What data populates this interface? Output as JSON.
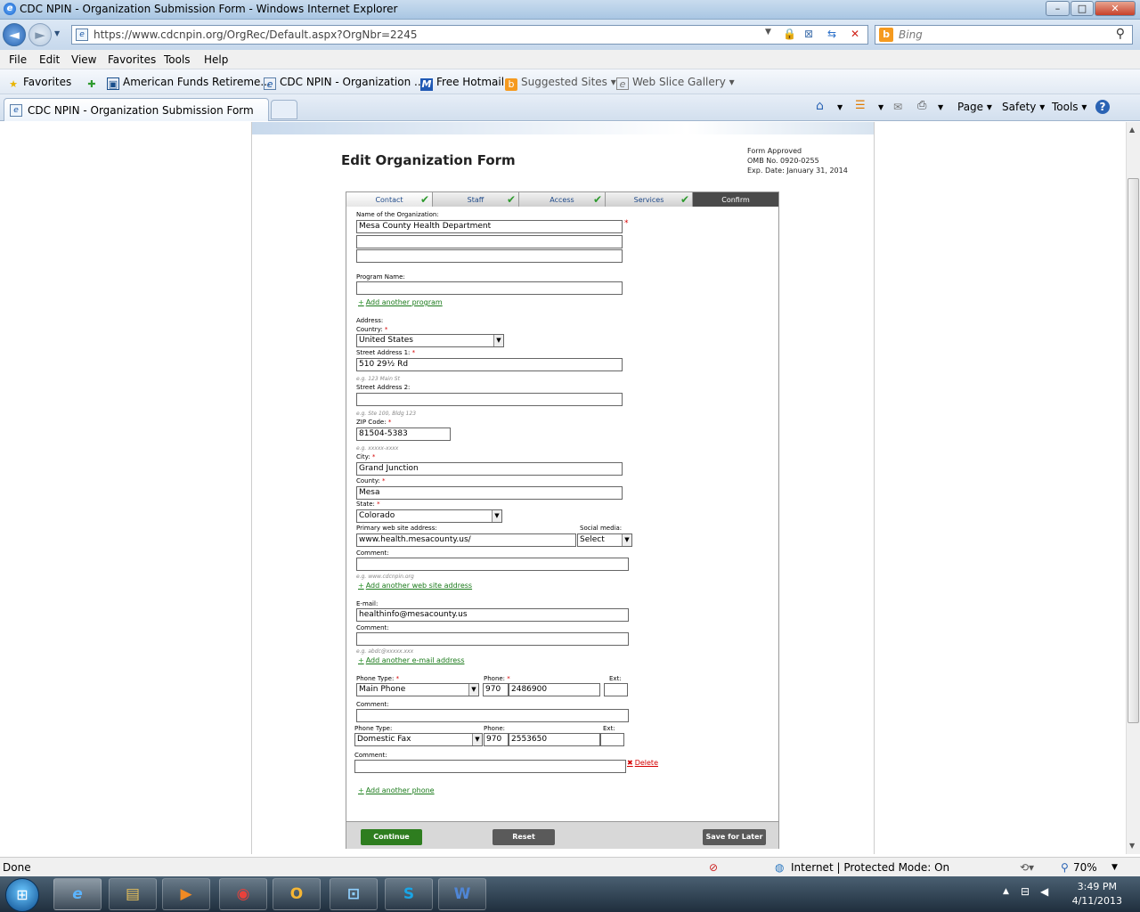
{
  "window": {
    "title": "CDC NPIN - Organization Submission Form - Windows Internet Explorer",
    "minimize": "–",
    "maximize": "□",
    "close": "✕"
  },
  "nav": {
    "url": "https://www.cdcnpin.org/OrgRec/Default.aspx?OrgNbr=2245",
    "search_placeholder": "Bing",
    "back": "◄",
    "forward": "►"
  },
  "menu": [
    "File",
    "Edit",
    "View",
    "Favorites",
    "Tools",
    "Help"
  ],
  "favorites_bar": {
    "favorites_label": "Favorites",
    "items": [
      "American Funds Retireme...",
      "CDC NPIN - Organization ...",
      "Free Hotmail",
      "Suggested Sites ▾",
      "Web Slice Gallery ▾"
    ]
  },
  "tabs": {
    "active": "CDC NPIN - Organization Submission Form"
  },
  "command_bar": [
    "Page ▾",
    "Safety ▾",
    "Tools ▾"
  ],
  "form": {
    "title": "Edit Organization Form",
    "omb": [
      "Form Approved",
      "OMB No. 0920-0255",
      "Exp. Date: January 31, 2014"
    ],
    "steps": [
      "Contact",
      "Staff",
      "Access",
      "Services",
      "Confirm"
    ],
    "labels": {
      "org_name": "Name of the Organization:",
      "program_name": "Program Name:",
      "address": "Address:",
      "country": "Country:",
      "street1": "Street Address 1:",
      "street2": "Street Address 2:",
      "zip": "ZIP Code:",
      "city": "City:",
      "county": "County:",
      "state": "State:",
      "website": "Primary web site address:",
      "social": "Social media:",
      "comment": "Comment:",
      "email": "E-mail:",
      "phone_type": "Phone Type:",
      "phone": "Phone:",
      "ext": "Ext:"
    },
    "values": {
      "org_name": "Mesa County Health Department",
      "country": "United States",
      "street1": "510 29½ Rd",
      "zip": "81504-5383",
      "city": "Grand Junction",
      "county": "Mesa",
      "state": "Colorado",
      "website": "www.health.mesacounty.us/",
      "social": "Select",
      "email": "healthinfo@mesacounty.us",
      "phone1_type": "Main Phone",
      "phone1_area": "970",
      "phone1_num": "2486900",
      "phone2_type": "Domestic Fax",
      "phone2_area": "970",
      "phone2_num": "2553650"
    },
    "hints": {
      "street1": "e.g. 123 Main St",
      "street2": "e.g. Ste 100, Bldg 123",
      "zip": "e.g. xxxxx-xxxx",
      "website": "e.g. www.cdcnpin.org",
      "email": "e.g. abdc@xxxxx.xxx"
    },
    "links": {
      "add_program": "Add another program",
      "add_website": "Add another web site address",
      "add_email": "Add another e-mail address",
      "add_phone": "Add another phone",
      "delete": "Delete"
    },
    "buttons": {
      "continue": "Continue",
      "reset": "Reset",
      "save_later": "Save for Later"
    },
    "colors": {
      "continue": "#2e7d1f",
      "reset": "#5a5a5a",
      "save_later": "#5a5a5a",
      "required": "#d40000",
      "link": "#1a7a1a"
    }
  },
  "status": {
    "left": "Done",
    "zone": "Internet | Protected Mode: On",
    "zoom": "70%"
  },
  "clock": {
    "time": "3:49 PM",
    "date": "4/11/2013"
  }
}
